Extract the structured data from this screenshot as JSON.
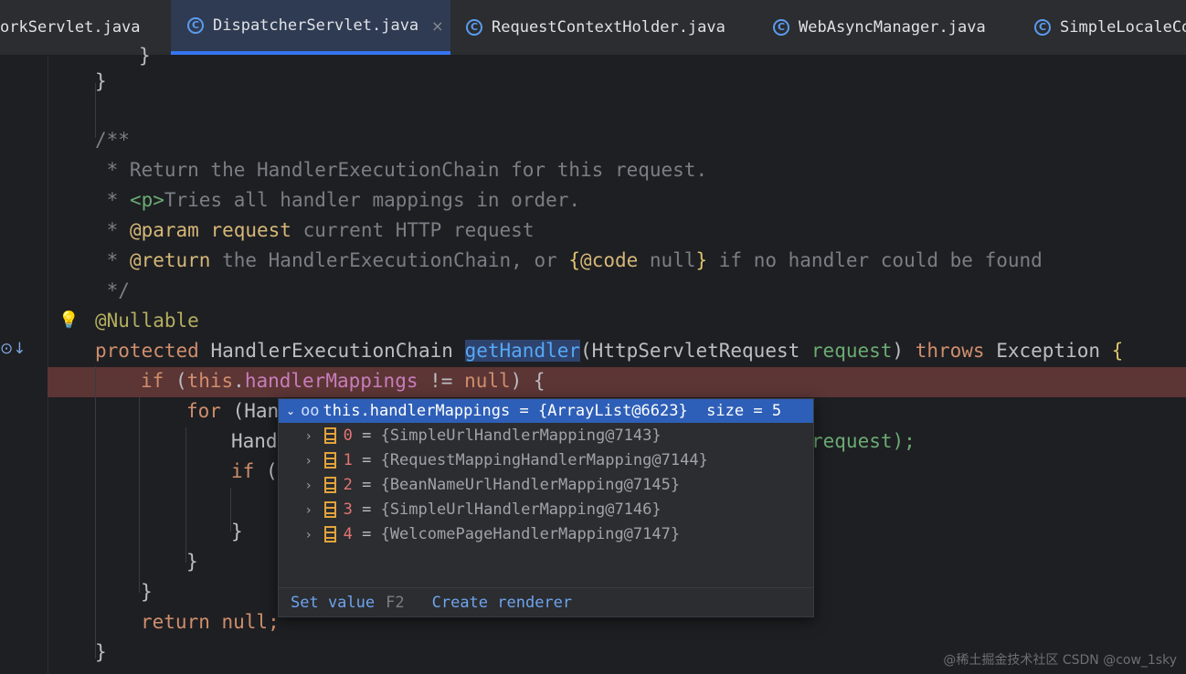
{
  "tabs": [
    {
      "label": "orkServlet.java",
      "active": false,
      "icon": "class-icon"
    },
    {
      "label": "DispatcherServlet.java",
      "active": true,
      "icon": "class-icon",
      "close": "×"
    },
    {
      "label": "RequestContextHolder.java",
      "active": false,
      "icon": "class-icon"
    },
    {
      "label": "WebAsyncManager.java",
      "active": false,
      "icon": "class-icon"
    },
    {
      "label": "SimpleLocaleCo",
      "active": false,
      "icon": "class-icon"
    }
  ],
  "code": {
    "l0": "}",
    "l1": "}",
    "doc_open": "/**",
    "doc1": " * Return the HandlerExecutionChain for this request.",
    "doc2_star": " * ",
    "doc2_tag": "<p>",
    "doc2_rest": "Tries all handler mappings in order.",
    "doc3_star": " * ",
    "doc3_tag": "@param",
    "doc3_name": "request",
    "doc3_rest": " current HTTP request",
    "doc4_star": " * ",
    "doc4_tag": "@return",
    "doc4_rest": " the HandlerExecutionChain, or ",
    "doc4_code_open": "{",
    "doc4_code": "@code",
    "doc4_null": " null",
    "doc4_code_close": "}",
    "doc4_tail": " if no handler could be found",
    "doc_close": " */",
    "annotation": "@Nullable",
    "sig_protected": "protected",
    "sig_type": " HandlerExecutionChain ",
    "sig_method": "getHandler",
    "sig_params": "(HttpServletRequest ",
    "sig_param_name": "request",
    "sig_close": ") ",
    "sig_throws": "throws",
    "sig_exc": " Exception ",
    "sig_brace": "{",
    "if_kw": "if",
    "if_open": " (",
    "if_this": "this",
    "if_dot": ".",
    "if_field": "handlerMappings",
    "if_ne": " != ",
    "if_null": "null",
    "if_close": ") {",
    "for_kw": "for",
    "for_rest": " (Han",
    "hand_line": "Hand",
    "hand_tail": "request);",
    "inner_if_kw": "if",
    "inner_if_rest": " (",
    "brace_inner": "}",
    "brace_for": "}",
    "brace_if": "}",
    "return_kw": "return",
    "return_null": " null;",
    "brace_method": "}"
  },
  "debug_popup": {
    "header": "this.handlerMappings = {ArrayList@6623}  size = 5",
    "items": [
      {
        "index": "0",
        "value": "{SimpleUrlHandlerMapping@7143}"
      },
      {
        "index": "1",
        "value": "{RequestMappingHandlerMapping@7144}"
      },
      {
        "index": "2",
        "value": "{BeanNameUrlHandlerMapping@7145}"
      },
      {
        "index": "3",
        "value": "{SimpleUrlHandlerMapping@7146}"
      },
      {
        "index": "4",
        "value": "{WelcomePageHandlerMapping@7147}"
      }
    ],
    "set_value": "Set value",
    "set_value_key": "F2",
    "create_renderer": "Create renderer"
  },
  "watermark": "@稀土掘金技术社区 CSDN @cow_1sky"
}
